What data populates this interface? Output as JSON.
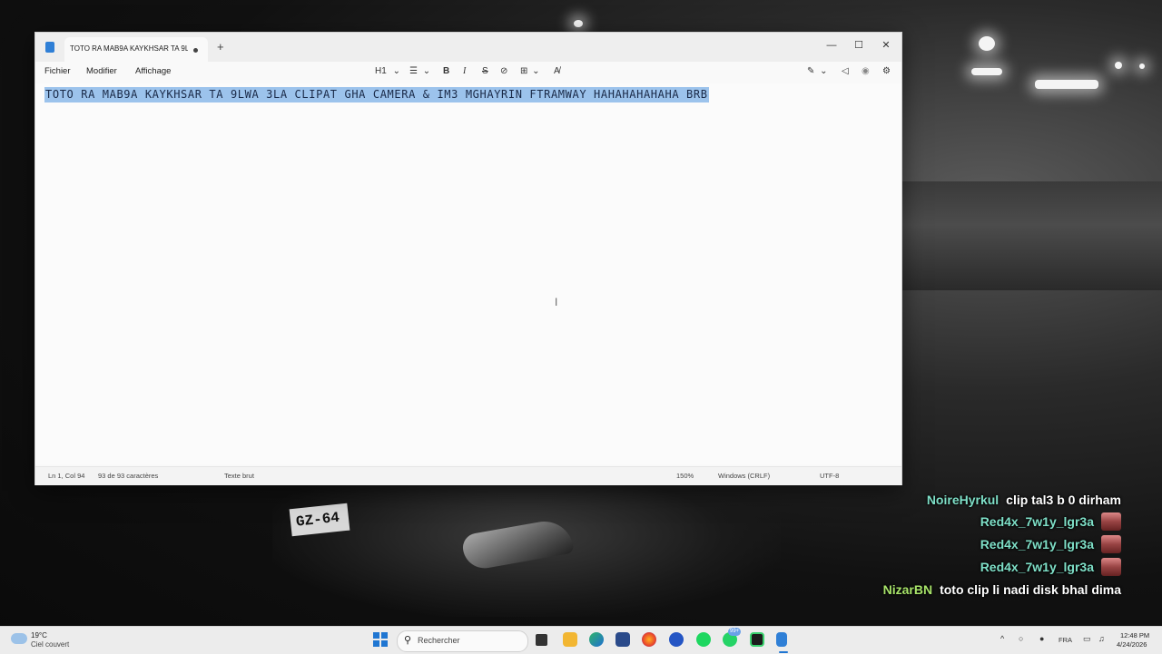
{
  "notepad": {
    "tab_title": "TOTO RA MAB9A KAYKHSAR TA 9L'",
    "new_tab": "+",
    "window_controls": {
      "minimize": "—",
      "maximize": "☐",
      "close": "✕"
    },
    "menu": {
      "file": "Fichier",
      "edit": "Modifier",
      "view": "Affichage"
    },
    "toolbar": {
      "heading": "H1",
      "heading_chevron": "⌄",
      "list": "☰",
      "list_chevron": "⌄",
      "bold": "B",
      "italic": "I",
      "strike": "S",
      "link": "⊘",
      "table": "⊞",
      "table_chevron": "⌄",
      "clear_format": "A̸",
      "copilot": "✎",
      "copilot_chevron": "⌄",
      "share": "◁",
      "account": "◉",
      "settings": "⚙"
    },
    "content": "TOTO RA MAB9A KAYKHSAR TA 9LWA 3LA CLIPAT GHA CAMERA & IM3 MGHAYRIN FTRAMWAY HAHAHAHAHAHA BRB",
    "status": {
      "position": "Ln 1, Col 94",
      "selection": "93 de 93 caractères",
      "format": "Texte brut",
      "zoom": "150%",
      "line_ending": "Windows (CRLF)",
      "encoding": "UTF-8"
    }
  },
  "background": {
    "plate": "GZ-64"
  },
  "chat": [
    {
      "user": "NoireHyrkul",
      "user_color": "#7fe0c8",
      "message": "clip tal3 b 0 dirham",
      "emote": false
    },
    {
      "user": "Red4x_7w1y_lgr3a",
      "user_color": "#7fe0c8",
      "message": "",
      "emote": true
    },
    {
      "user": "Red4x_7w1y_lgr3a",
      "user_color": "#7fe0c8",
      "message": "",
      "emote": true
    },
    {
      "user": "Red4x_7w1y_lgr3a",
      "user_color": "#7fe0c8",
      "message": "",
      "emote": true
    },
    {
      "user": "NizarBN",
      "user_color": "#a8e46a",
      "message": "toto clip li nadi disk bhal dima",
      "emote": false
    }
  ],
  "taskbar": {
    "weather_temp": "19°C",
    "weather_desc": "Ciel couvert",
    "search_placeholder": "Rechercher",
    "notification_badge": "99+",
    "tray": {
      "chevron": "^",
      "lang": "FRA"
    },
    "time": "12:48 PM",
    "date": "4/24/2026"
  },
  "colors": {
    "accent": "#1f76d2",
    "selection": "#9cc3ec"
  }
}
